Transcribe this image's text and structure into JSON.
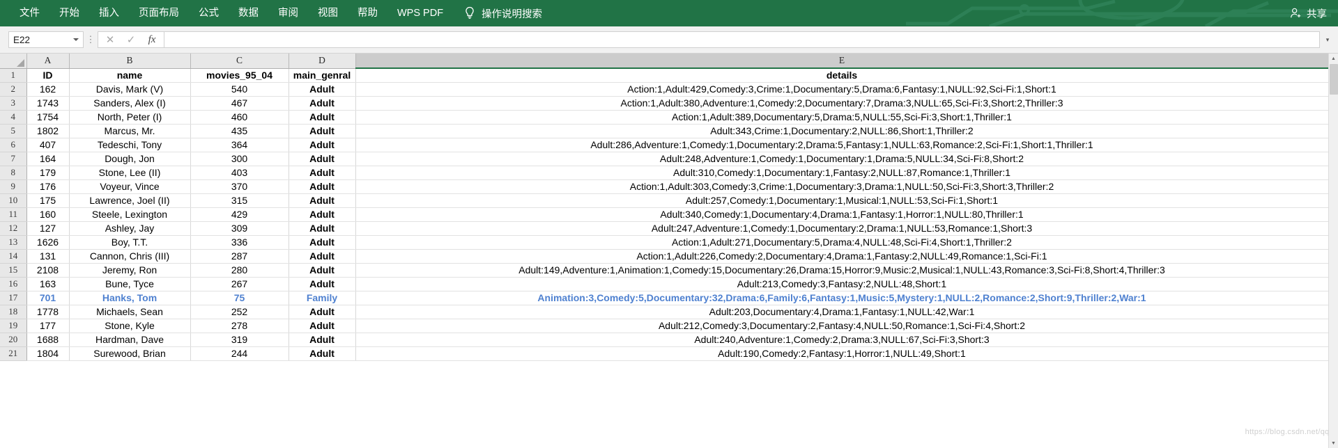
{
  "titlebar": {
    "menu_items": [
      "文件",
      "开始",
      "插入",
      "页面布局",
      "公式",
      "数据",
      "审阅",
      "视图",
      "帮助",
      "WPS PDF"
    ],
    "tellme_label": "操作说明搜索",
    "tellme_icon": "lightbulb-icon",
    "share_label": "共享",
    "share_icon": "person-add-icon",
    "background_color": "#217346"
  },
  "formula_bar": {
    "namebox_value": "E22",
    "cancel_icon": "close-icon",
    "confirm_icon": "check-icon",
    "function_icon": "fx-icon",
    "formula_value": "",
    "expand_icon": "chevron-down-icon"
  },
  "grid": {
    "column_headers": [
      "A",
      "B",
      "C",
      "D",
      "E"
    ],
    "selected_column": "E",
    "header_row_number": "1",
    "columns": [
      "ID",
      "name",
      "movies_95_04",
      "main_genral",
      "details"
    ],
    "rows": [
      {
        "n": "1",
        "style": "header",
        "id": "ID",
        "name": "name",
        "movies": "movies_95_04",
        "genre": "main_genral",
        "details": "details"
      },
      {
        "n": "2",
        "style": "normal",
        "id": "162",
        "name": "Davis, Mark (V)",
        "movies": "540",
        "genre": "Adult",
        "details": "Action:1,Adult:429,Comedy:3,Crime:1,Documentary:5,Drama:6,Fantasy:1,NULL:92,Sci-Fi:1,Short:1"
      },
      {
        "n": "3",
        "style": "normal",
        "id": "1743",
        "name": "Sanders, Alex (I)",
        "movies": "467",
        "genre": "Adult",
        "details": "Action:1,Adult:380,Adventure:1,Comedy:2,Documentary:7,Drama:3,NULL:65,Sci-Fi:3,Short:2,Thriller:3"
      },
      {
        "n": "4",
        "style": "normal",
        "id": "1754",
        "name": "North, Peter (I)",
        "movies": "460",
        "genre": "Adult",
        "details": "Action:1,Adult:389,Documentary:5,Drama:5,NULL:55,Sci-Fi:3,Short:1,Thriller:1"
      },
      {
        "n": "5",
        "style": "normal",
        "id": "1802",
        "name": "Marcus, Mr.",
        "movies": "435",
        "genre": "Adult",
        "details": "Adult:343,Crime:1,Documentary:2,NULL:86,Short:1,Thriller:2"
      },
      {
        "n": "6",
        "style": "normal",
        "id": "407",
        "name": "Tedeschi, Tony",
        "movies": "364",
        "genre": "Adult",
        "details": "Adult:286,Adventure:1,Comedy:1,Documentary:2,Drama:5,Fantasy:1,NULL:63,Romance:2,Sci-Fi:1,Short:1,Thriller:1"
      },
      {
        "n": "7",
        "style": "normal",
        "id": "164",
        "name": "Dough, Jon",
        "movies": "300",
        "genre": "Adult",
        "details": "Adult:248,Adventure:1,Comedy:1,Documentary:1,Drama:5,NULL:34,Sci-Fi:8,Short:2"
      },
      {
        "n": "8",
        "style": "normal",
        "id": "179",
        "name": "Stone, Lee (II)",
        "movies": "403",
        "genre": "Adult",
        "details": "Adult:310,Comedy:1,Documentary:1,Fantasy:2,NULL:87,Romance:1,Thriller:1"
      },
      {
        "n": "9",
        "style": "normal",
        "id": "176",
        "name": "Voyeur, Vince",
        "movies": "370",
        "genre": "Adult",
        "details": "Action:1,Adult:303,Comedy:3,Crime:1,Documentary:3,Drama:1,NULL:50,Sci-Fi:3,Short:3,Thriller:2"
      },
      {
        "n": "10",
        "style": "normal",
        "id": "175",
        "name": "Lawrence, Joel (II)",
        "movies": "315",
        "genre": "Adult",
        "details": "Adult:257,Comedy:1,Documentary:1,Musical:1,NULL:53,Sci-Fi:1,Short:1"
      },
      {
        "n": "11",
        "style": "normal",
        "id": "160",
        "name": "Steele, Lexington",
        "movies": "429",
        "genre": "Adult",
        "details": "Adult:340,Comedy:1,Documentary:4,Drama:1,Fantasy:1,Horror:1,NULL:80,Thriller:1"
      },
      {
        "n": "12",
        "style": "normal",
        "id": "127",
        "name": "Ashley, Jay",
        "movies": "309",
        "genre": "Adult",
        "details": "Adult:247,Adventure:1,Comedy:1,Documentary:2,Drama:1,NULL:53,Romance:1,Short:3"
      },
      {
        "n": "13",
        "style": "normal",
        "id": "1626",
        "name": "Boy, T.T.",
        "movies": "336",
        "genre": "Adult",
        "details": "Action:1,Adult:271,Documentary:5,Drama:4,NULL:48,Sci-Fi:4,Short:1,Thriller:2"
      },
      {
        "n": "14",
        "style": "normal",
        "id": "131",
        "name": "Cannon, Chris (III)",
        "movies": "287",
        "genre": "Adult",
        "details": "Action:1,Adult:226,Comedy:2,Documentary:4,Drama:1,Fantasy:2,NULL:49,Romance:1,Sci-Fi:1"
      },
      {
        "n": "15",
        "style": "normal",
        "id": "2108",
        "name": "Jeremy, Ron",
        "movies": "280",
        "genre": "Adult",
        "details": "Adult:149,Adventure:1,Animation:1,Comedy:15,Documentary:26,Drama:15,Horror:9,Music:2,Musical:1,NULL:43,Romance:3,Sci-Fi:8,Short:4,Thriller:3"
      },
      {
        "n": "16",
        "style": "normal",
        "id": "163",
        "name": "Bune, Tyce",
        "movies": "267",
        "genre": "Adult",
        "details": "Adult:213,Comedy:3,Fantasy:2,NULL:48,Short:1"
      },
      {
        "n": "17",
        "style": "blue",
        "id": "701",
        "name": "Hanks, Tom",
        "movies": "75",
        "genre": "Family",
        "details": "Animation:3,Comedy:5,Documentary:32,Drama:6,Family:6,Fantasy:1,Music:5,Mystery:1,NULL:2,Romance:2,Short:9,Thriller:2,War:1"
      },
      {
        "n": "18",
        "style": "normal",
        "id": "1778",
        "name": "Michaels, Sean",
        "movies": "252",
        "genre": "Adult",
        "details": "Adult:203,Documentary:4,Drama:1,Fantasy:1,NULL:42,War:1"
      },
      {
        "n": "19",
        "style": "normal",
        "id": "177",
        "name": "Stone, Kyle",
        "movies": "278",
        "genre": "Adult",
        "details": "Adult:212,Comedy:3,Documentary:2,Fantasy:4,NULL:50,Romance:1,Sci-Fi:4,Short:2"
      },
      {
        "n": "20",
        "style": "normal",
        "id": "1688",
        "name": "Hardman, Dave",
        "movies": "319",
        "genre": "Adult",
        "details": "Adult:240,Adventure:1,Comedy:2,Drama:3,NULL:67,Sci-Fi:3,Short:3"
      },
      {
        "n": "21",
        "style": "normal",
        "id": "1804",
        "name": "Surewood, Brian",
        "movies": "244",
        "genre": "Adult",
        "details": "Adult:190,Comedy:2,Fantasy:1,Horror:1,NULL:49,Short:1"
      }
    ],
    "adult_color": "#ff0000",
    "highlight_color": "#4f81d0"
  },
  "watermark": "https://blog.csdn.net/qq_"
}
